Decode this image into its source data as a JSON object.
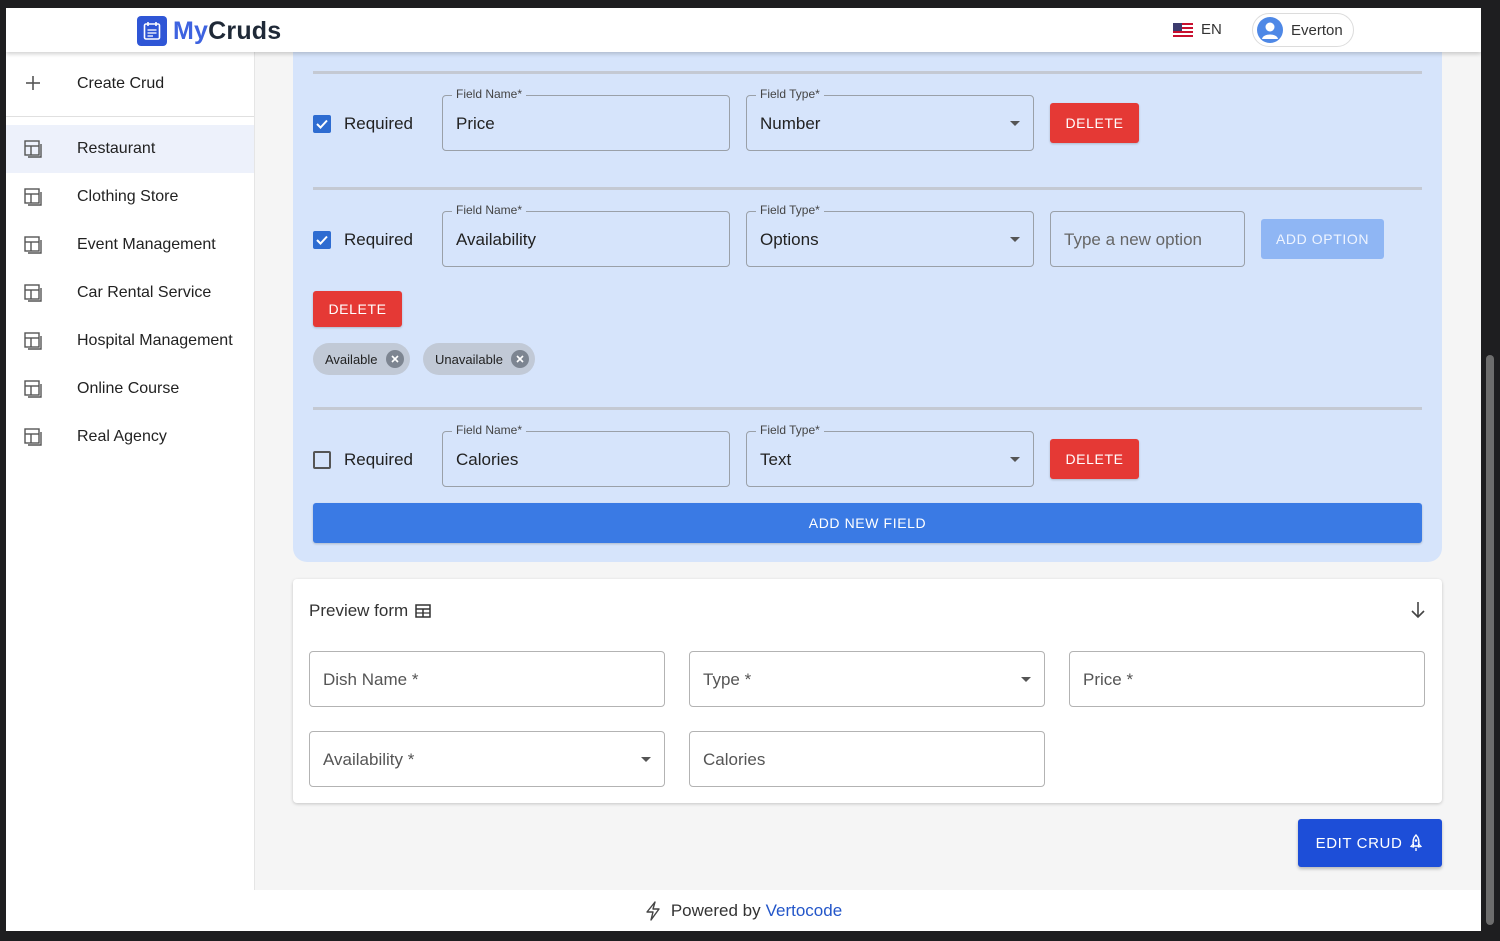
{
  "app": {
    "logo_my": "My",
    "logo_cruds": "Cruds",
    "language": "EN",
    "user_name": "Everton"
  },
  "sidebar": {
    "create_label": "Create Crud",
    "items": [
      {
        "label": "Restaurant",
        "active": true
      },
      {
        "label": "Clothing Store",
        "active": false
      },
      {
        "label": "Event Management",
        "active": false
      },
      {
        "label": "Car Rental Service",
        "active": false
      },
      {
        "label": "Hospital Management",
        "active": false
      },
      {
        "label": "Online Course",
        "active": false
      },
      {
        "label": "Real Agency",
        "active": false
      }
    ]
  },
  "fields": [
    {
      "required_label": "Required",
      "required": true,
      "name_label": "Field Name",
      "name": "Price",
      "type_label": "Field Type",
      "type": "Number",
      "delete_label": "DELETE"
    },
    {
      "required_label": "Required",
      "required": true,
      "name_label": "Field Name",
      "name": "Availability",
      "type_label": "Field Type",
      "type": "Options",
      "option_placeholder": "Type a new option",
      "add_option_label": "ADD OPTION",
      "delete_label": "DELETE",
      "options": [
        "Available",
        "Unavailable"
      ]
    },
    {
      "required_label": "Required",
      "required": false,
      "name_label": "Field Name",
      "name": "Calories",
      "type_label": "Field Type",
      "type": "Text",
      "delete_label": "DELETE"
    }
  ],
  "required_asterisk": "*",
  "add_field_label": "ADD NEW FIELD",
  "preview": {
    "title": "Preview form",
    "fields": [
      {
        "label": "Dish Name",
        "required": true,
        "kind": "text"
      },
      {
        "label": "Type",
        "required": true,
        "kind": "select"
      },
      {
        "label": "Price",
        "required": true,
        "kind": "text"
      },
      {
        "label": "Availability",
        "required": true,
        "kind": "select"
      },
      {
        "label": "Calories",
        "required": false,
        "kind": "text"
      }
    ]
  },
  "edit_label": "EDIT CRUD",
  "footer": {
    "prefix": "Powered by",
    "link": "Vertocode"
  },
  "colors": {
    "accent": "#3a7ae4",
    "danger": "#e53935",
    "panel_bg": "#d6e4fb",
    "edit_button": "#1d4ed8"
  },
  "icons": [
    "calendar-logo-icon",
    "us-flag-icon",
    "user-avatar-icon",
    "plus-icon",
    "table-layout-icon",
    "check-icon",
    "caret-down-icon",
    "close-circle-icon",
    "table-icon",
    "arrow-down-icon",
    "rocket-icon",
    "lightning-icon"
  ]
}
